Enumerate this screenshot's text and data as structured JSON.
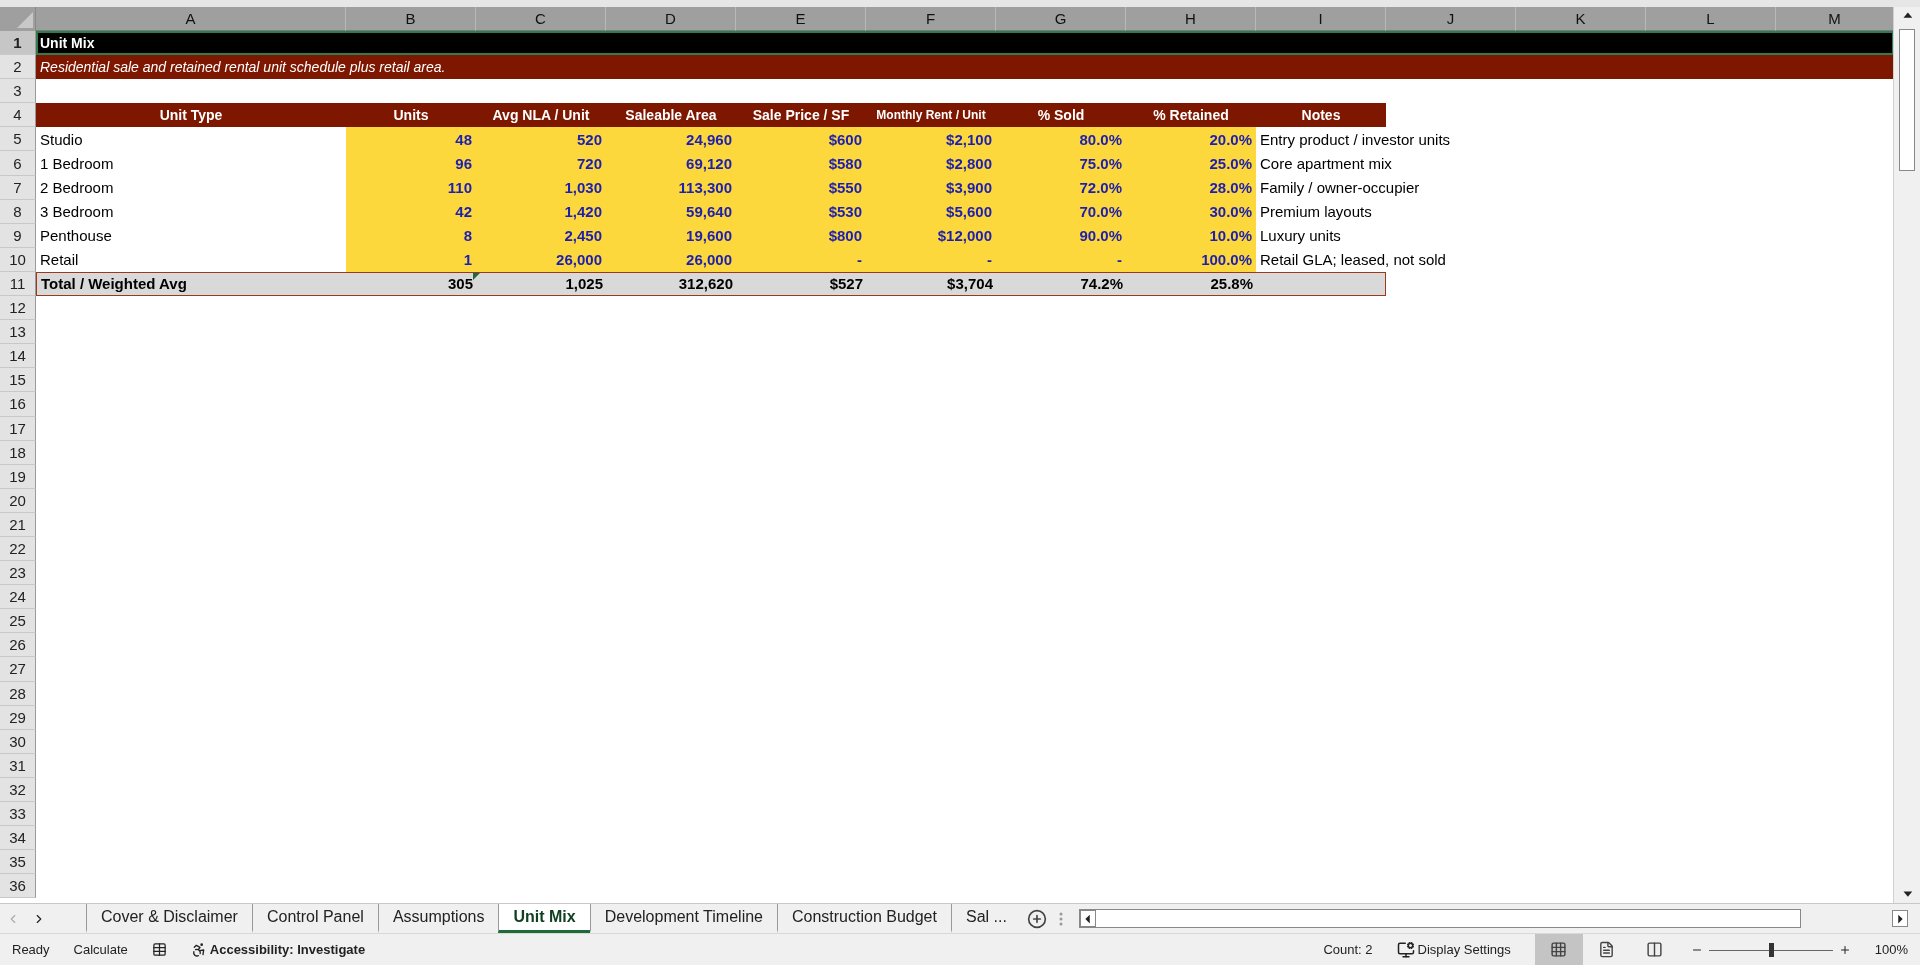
{
  "column_headers": [
    "A",
    "B",
    "C",
    "D",
    "E",
    "F",
    "G",
    "H",
    "I",
    "J",
    "K",
    "L",
    "M"
  ],
  "row_numbers": [
    "1",
    "2",
    "3",
    "4",
    "5",
    "6",
    "7",
    "8",
    "9",
    "10",
    "11",
    "12",
    "13",
    "14",
    "15",
    "16",
    "17",
    "18",
    "19",
    "20",
    "21",
    "22",
    "23",
    "24",
    "25",
    "26",
    "27",
    "28",
    "29",
    "30",
    "31",
    "32",
    "33",
    "34",
    "35",
    "36"
  ],
  "title": {
    "text": "Unit Mix",
    "selected": true
  },
  "subtitle": "Residential sale and retained rental unit schedule plus retail area.",
  "table": {
    "columns": [
      "Unit Type",
      "Units",
      "Avg NLA / Unit",
      "Saleable Area",
      "Sale Price / SF",
      "Monthly Rent / Unit",
      "% Sold",
      "% Retained",
      "Notes"
    ],
    "rows": [
      {
        "cells": [
          "Studio",
          "48",
          "520",
          "24,960",
          "$600",
          "$2,100",
          "80.0%",
          "20.0%",
          "Entry product / investor units"
        ]
      },
      {
        "cells": [
          "1 Bedroom",
          "96",
          "720",
          "69,120",
          "$580",
          "$2,800",
          "75.0%",
          "25.0%",
          "Core apartment mix"
        ]
      },
      {
        "cells": [
          "2 Bedroom",
          "110",
          "1,030",
          "113,300",
          "$550",
          "$3,900",
          "72.0%",
          "28.0%",
          "Family / owner-occupier"
        ]
      },
      {
        "cells": [
          "3 Bedroom",
          "42",
          "1,420",
          "59,640",
          "$530",
          "$5,600",
          "70.0%",
          "30.0%",
          "Premium layouts"
        ]
      },
      {
        "cells": [
          "Penthouse",
          "8",
          "2,450",
          "19,600",
          "$800",
          "$12,000",
          "90.0%",
          "10.0%",
          "Luxury units"
        ]
      },
      {
        "cells": [
          "Retail",
          "1",
          "26,000",
          "26,000",
          "-",
          "-",
          "-",
          "100.0%",
          "Retail GLA; leased, not sold"
        ]
      }
    ],
    "total": {
      "cells": [
        "Total / Weighted Avg",
        "305",
        "1,025",
        "312,620",
        "$527",
        "$3,704",
        "74.2%",
        "25.8%"
      ]
    }
  },
  "sheet_tabs": [
    {
      "label": "Cover & Disclaimer",
      "selected": false
    },
    {
      "label": "Control Panel",
      "selected": false
    },
    {
      "label": "Assumptions",
      "selected": false
    },
    {
      "label": "Unit Mix",
      "selected": true
    },
    {
      "label": "Development Timeline",
      "selected": false
    },
    {
      "label": "Construction Budget",
      "selected": false
    },
    {
      "label": "Sal ...",
      "selected": false
    }
  ],
  "status_bar": {
    "mode": "Ready",
    "calculate": "Calculate",
    "accessibility": "Accessibility: Investigate",
    "count": "Count: 2",
    "display_settings": "Display Settings",
    "views": [
      {
        "kind": "normal",
        "selected": true
      },
      {
        "kind": "page_layout",
        "selected": false
      },
      {
        "kind": "page_break",
        "selected": false
      }
    ],
    "zoom": {
      "level": 0.5,
      "reading": "100%"
    }
  }
}
